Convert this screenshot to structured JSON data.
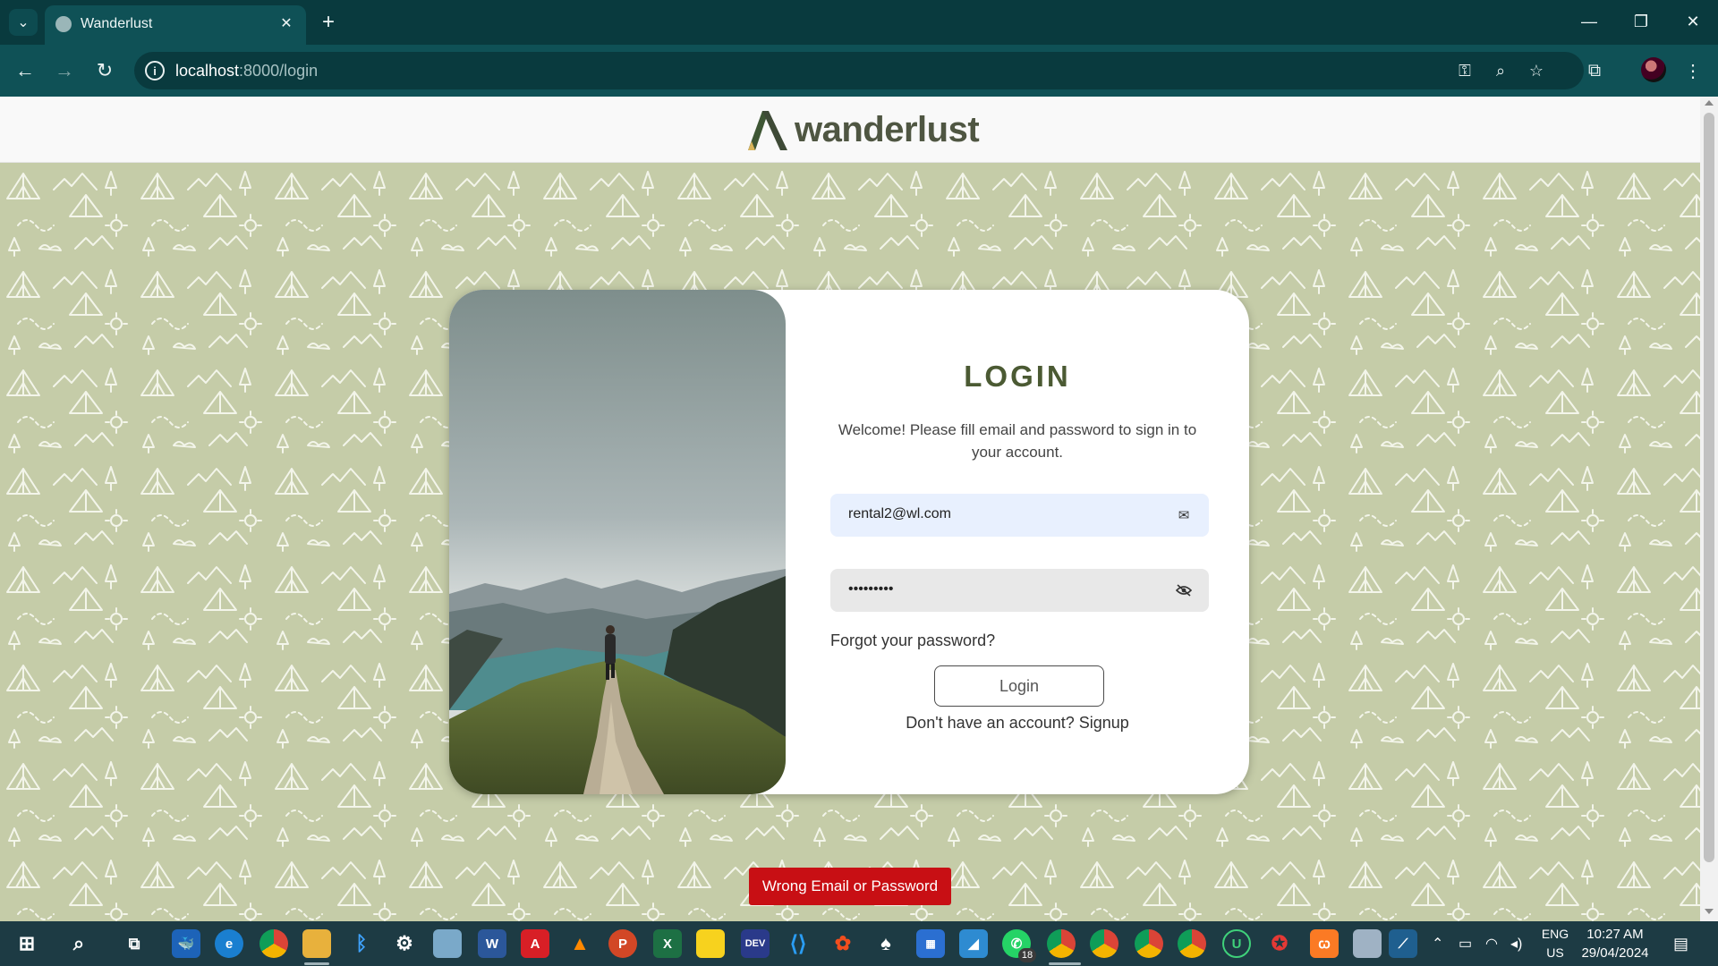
{
  "browser": {
    "tab_title": "Wanderlust",
    "url_host": "localhost",
    "url_rest": ":8000/login",
    "close_tab": "✕",
    "new_tab": "+"
  },
  "page": {
    "brand": "wanderlust",
    "login_title": "LOGIN",
    "welcome_text": "Welcome! Please fill email and password to sign in to your account.",
    "email_value": "rental2@wl.com",
    "password_value": "•••••••••",
    "forgot_link": "Forgot your password?",
    "login_button": "Login",
    "signup_text": "Don't have an account? Signup",
    "error_message": "Wrong Email or Password"
  },
  "taskbar": {
    "lang_line1": "ENG",
    "lang_line2": "US",
    "time": "10:27 AM",
    "date": "29/04/2024",
    "whatsapp_badge": "18"
  }
}
